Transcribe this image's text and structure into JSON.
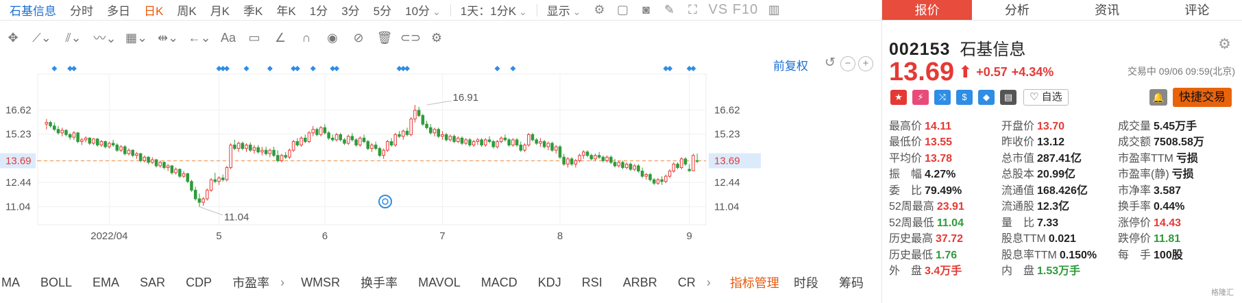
{
  "stock": {
    "code": "002153",
    "name": "石基信息"
  },
  "period_tabs": [
    "石基信息",
    "分时",
    "多日",
    "日K",
    "周K",
    "月K",
    "季K",
    "年K",
    "1分",
    "3分",
    "5分",
    "10分"
  ],
  "period_selected": "日K",
  "period_range": "1天：1分K",
  "display_label": "显示",
  "vs_label": "VS F10",
  "draw_tools": [
    "move-icon",
    "line-icon",
    "channel-icon",
    "wave-icon",
    "fib-icon",
    "range-icon",
    "arrow-icon",
    "text-icon",
    "comment-icon",
    "ruler-icon",
    "magnet-icon",
    "eye-icon",
    "lock-icon",
    "trash-icon",
    "link-icon",
    "settings-icon"
  ],
  "adjust_label": "前复权",
  "indicators": [
    "MA",
    "BOLL",
    "EMA",
    "SAR",
    "CDP",
    "市盈率",
    "WMSR",
    "换手率",
    "MAVOL",
    "MACD",
    "KDJ",
    "RSI",
    "ARBR",
    "CR"
  ],
  "indicator_manage": "指标管理",
  "right_links": [
    "时段",
    "筹码"
  ],
  "colors": {
    "up": "#e53935",
    "down": "#2e9b3a",
    "accent": "#e8590c",
    "link": "#1a6fd1"
  },
  "chart_data": {
    "type": "candlestick",
    "y_ticks": [
      16.62,
      15.23,
      13.69,
      12.44,
      11.04
    ],
    "y_range": [
      10.0,
      17.9
    ],
    "x_labels": [
      "2022/04",
      "5",
      "6",
      "7",
      "8",
      "9"
    ],
    "x_label_index": [
      16,
      44,
      71,
      101,
      131,
      164
    ],
    "current_price": 13.69,
    "annotations": [
      {
        "label": "16.91",
        "index": 97,
        "value": 16.91
      },
      {
        "label": "11.04",
        "index": 39,
        "value": 11.04
      }
    ],
    "event_marker_index": [
      2,
      6,
      7,
      44,
      45,
      46,
      51,
      57,
      63,
      64,
      68,
      73,
      74,
      90,
      91,
      92,
      115,
      119,
      158,
      159,
      164,
      165
    ],
    "ohlc": [
      [
        15.8,
        16.1,
        15.5,
        15.9
      ],
      [
        15.9,
        16.0,
        15.6,
        15.7
      ],
      [
        15.7,
        15.9,
        15.4,
        15.5
      ],
      [
        15.5,
        15.7,
        15.2,
        15.3
      ],
      [
        15.3,
        15.6,
        15.1,
        15.45
      ],
      [
        15.45,
        15.5,
        15.1,
        15.2
      ],
      [
        15.2,
        15.3,
        14.9,
        15.05
      ],
      [
        15.05,
        15.4,
        14.9,
        15.3
      ],
      [
        15.3,
        15.35,
        14.7,
        14.8
      ],
      [
        14.8,
        15.0,
        14.6,
        14.9
      ],
      [
        14.9,
        15.1,
        14.75,
        15.0
      ],
      [
        15.0,
        15.05,
        14.6,
        14.7
      ],
      [
        14.7,
        15.0,
        14.6,
        14.95
      ],
      [
        14.95,
        15.0,
        14.5,
        14.6
      ],
      [
        14.6,
        14.9,
        14.5,
        14.8
      ],
      [
        14.8,
        14.85,
        14.4,
        14.5
      ],
      [
        14.5,
        14.8,
        14.4,
        14.7
      ],
      [
        14.7,
        14.9,
        14.5,
        14.6
      ],
      [
        14.6,
        14.7,
        14.2,
        14.3
      ],
      [
        14.3,
        14.6,
        14.2,
        14.5
      ],
      [
        14.5,
        14.6,
        14.0,
        14.1
      ],
      [
        14.1,
        14.4,
        14.0,
        14.3
      ],
      [
        14.3,
        14.35,
        13.9,
        14.0
      ],
      [
        14.0,
        14.2,
        13.8,
        14.1
      ],
      [
        14.1,
        14.15,
        13.6,
        13.7
      ],
      [
        13.7,
        14.0,
        13.6,
        13.9
      ],
      [
        13.9,
        13.95,
        13.5,
        13.6
      ],
      [
        13.6,
        13.9,
        13.5,
        13.75
      ],
      [
        13.75,
        13.8,
        13.3,
        13.4
      ],
      [
        13.4,
        13.7,
        13.3,
        13.6
      ],
      [
        13.6,
        13.65,
        13.2,
        13.3
      ],
      [
        13.3,
        13.5,
        13.1,
        13.4
      ],
      [
        13.4,
        13.45,
        12.9,
        13.0
      ],
      [
        13.0,
        13.3,
        12.9,
        13.2
      ],
      [
        13.2,
        13.25,
        12.7,
        12.8
      ],
      [
        12.8,
        13.1,
        12.7,
        12.95
      ],
      [
        12.95,
        13.0,
        12.4,
        12.5
      ],
      [
        12.5,
        12.6,
        11.9,
        12.0
      ],
      [
        12.0,
        12.2,
        11.4,
        11.5
      ],
      [
        11.5,
        11.8,
        11.04,
        11.3
      ],
      [
        11.3,
        11.6,
        11.1,
        11.5
      ],
      [
        11.5,
        12.1,
        11.4,
        12.0
      ],
      [
        12.0,
        12.7,
        11.9,
        12.6
      ],
      [
        12.6,
        13.0,
        12.4,
        12.5
      ],
      [
        12.5,
        12.8,
        12.3,
        12.7
      ],
      [
        12.7,
        12.9,
        12.5,
        12.6
      ],
      [
        12.6,
        13.4,
        12.5,
        13.3
      ],
      [
        13.3,
        14.7,
        13.2,
        14.6
      ],
      [
        14.6,
        14.9,
        14.3,
        14.4
      ],
      [
        14.4,
        14.8,
        14.2,
        14.7
      ],
      [
        14.7,
        14.8,
        14.3,
        14.4
      ],
      [
        14.4,
        14.7,
        14.2,
        14.6
      ],
      [
        14.6,
        14.75,
        14.2,
        14.3
      ],
      [
        14.3,
        14.6,
        14.1,
        14.45
      ],
      [
        14.45,
        14.6,
        14.1,
        14.2
      ],
      [
        14.2,
        14.5,
        14.0,
        14.3
      ],
      [
        14.3,
        14.5,
        14.0,
        14.1
      ],
      [
        14.1,
        14.4,
        13.9,
        14.3
      ],
      [
        14.3,
        14.5,
        13.9,
        14.0
      ],
      [
        14.0,
        14.3,
        13.6,
        13.7
      ],
      [
        13.7,
        14.1,
        13.6,
        14.0
      ],
      [
        14.0,
        14.2,
        13.8,
        13.9
      ],
      [
        13.9,
        14.4,
        13.8,
        14.3
      ],
      [
        14.3,
        14.9,
        14.2,
        14.8
      ],
      [
        14.8,
        15.0,
        14.5,
        14.6
      ],
      [
        14.6,
        15.1,
        14.5,
        15.0
      ],
      [
        15.0,
        15.2,
        14.7,
        14.8
      ],
      [
        14.8,
        15.4,
        14.7,
        15.3
      ],
      [
        15.3,
        15.7,
        15.1,
        15.5
      ],
      [
        15.5,
        15.6,
        15.1,
        15.2
      ],
      [
        15.2,
        15.7,
        15.1,
        15.6
      ],
      [
        15.6,
        15.8,
        15.2,
        15.3
      ],
      [
        15.3,
        15.4,
        14.9,
        15.0
      ],
      [
        15.0,
        15.2,
        14.8,
        14.9
      ],
      [
        14.9,
        15.3,
        14.8,
        15.2
      ],
      [
        15.2,
        15.3,
        14.8,
        14.9
      ],
      [
        14.9,
        15.0,
        14.6,
        14.7
      ],
      [
        14.7,
        15.2,
        14.6,
        15.1
      ],
      [
        15.1,
        15.3,
        14.8,
        14.9
      ],
      [
        14.9,
        15.0,
        14.5,
        14.6
      ],
      [
        14.6,
        15.1,
        14.5,
        15.0
      ],
      [
        15.0,
        15.2,
        14.7,
        14.8
      ],
      [
        14.8,
        14.9,
        14.3,
        14.4
      ],
      [
        14.4,
        14.7,
        14.2,
        14.6
      ],
      [
        14.6,
        14.8,
        14.3,
        14.4
      ],
      [
        14.4,
        14.5,
        13.9,
        14.0
      ],
      [
        14.0,
        14.4,
        13.8,
        14.3
      ],
      [
        14.3,
        14.9,
        14.2,
        14.8
      ],
      [
        14.8,
        15.0,
        14.5,
        14.6
      ],
      [
        14.6,
        15.3,
        14.5,
        15.2
      ],
      [
        15.2,
        15.4,
        15.0,
        15.1
      ],
      [
        15.1,
        15.5,
        14.9,
        15.4
      ],
      [
        15.4,
        15.6,
        15.1,
        15.2
      ],
      [
        15.2,
        16.2,
        15.1,
        16.1
      ],
      [
        16.1,
        16.91,
        15.9,
        16.6
      ],
      [
        16.6,
        16.8,
        16.2,
        16.3
      ],
      [
        16.3,
        16.4,
        15.7,
        15.8
      ],
      [
        15.8,
        16.0,
        15.5,
        15.6
      ],
      [
        15.6,
        15.8,
        15.2,
        15.3
      ],
      [
        15.3,
        15.6,
        15.1,
        15.5
      ],
      [
        15.5,
        15.6,
        15.0,
        15.1
      ],
      [
        15.1,
        15.4,
        14.9,
        15.2
      ],
      [
        15.2,
        15.3,
        14.8,
        14.9
      ],
      [
        14.9,
        15.2,
        14.8,
        15.1
      ],
      [
        15.1,
        15.2,
        14.7,
        14.8
      ],
      [
        14.8,
        15.1,
        14.7,
        15.0
      ],
      [
        15.0,
        15.1,
        14.6,
        14.7
      ],
      [
        14.7,
        15.0,
        14.6,
        14.9
      ],
      [
        14.9,
        15.0,
        14.5,
        14.6
      ],
      [
        14.6,
        14.9,
        14.5,
        14.8
      ],
      [
        14.8,
        15.0,
        14.6,
        14.9
      ],
      [
        14.9,
        15.0,
        14.5,
        14.6
      ],
      [
        14.6,
        15.0,
        14.5,
        14.9
      ],
      [
        14.9,
        15.1,
        14.7,
        14.8
      ],
      [
        14.8,
        14.9,
        14.4,
        14.5
      ],
      [
        14.5,
        14.9,
        14.4,
        14.8
      ],
      [
        14.8,
        15.1,
        14.7,
        15.0
      ],
      [
        15.0,
        15.2,
        14.8,
        14.9
      ],
      [
        14.9,
        15.0,
        14.5,
        14.6
      ],
      [
        14.6,
        15.0,
        14.5,
        14.9
      ],
      [
        14.9,
        15.0,
        14.5,
        14.6
      ],
      [
        14.6,
        14.8,
        14.2,
        14.3
      ],
      [
        14.3,
        14.7,
        14.2,
        14.6
      ],
      [
        14.6,
        15.3,
        14.5,
        15.2
      ],
      [
        15.2,
        15.3,
        14.8,
        14.9
      ],
      [
        14.9,
        15.0,
        14.6,
        14.7
      ],
      [
        14.7,
        15.0,
        14.5,
        14.8
      ],
      [
        14.8,
        14.9,
        14.4,
        14.5
      ],
      [
        14.5,
        14.8,
        14.3,
        14.7
      ],
      [
        14.7,
        14.8,
        14.2,
        14.3
      ],
      [
        14.3,
        14.6,
        14.1,
        14.5
      ],
      [
        14.5,
        14.6,
        13.8,
        13.9
      ],
      [
        13.9,
        14.1,
        13.4,
        13.5
      ],
      [
        13.5,
        13.9,
        13.3,
        13.8
      ],
      [
        13.8,
        13.9,
        13.4,
        13.5
      ],
      [
        13.5,
        13.8,
        13.3,
        13.7
      ],
      [
        13.7,
        14.1,
        13.6,
        14.0
      ],
      [
        14.0,
        14.3,
        13.8,
        14.2
      ],
      [
        14.2,
        14.3,
        13.9,
        14.0
      ],
      [
        14.0,
        14.1,
        13.7,
        13.8
      ],
      [
        13.8,
        14.1,
        13.7,
        14.0
      ],
      [
        14.0,
        14.2,
        13.8,
        13.9
      ],
      [
        13.9,
        14.0,
        13.6,
        13.7
      ],
      [
        13.7,
        14.0,
        13.6,
        13.9
      ],
      [
        13.9,
        14.0,
        13.5,
        13.6
      ],
      [
        13.6,
        13.8,
        13.3,
        13.4
      ],
      [
        13.4,
        13.7,
        13.3,
        13.6
      ],
      [
        13.6,
        13.7,
        13.2,
        13.3
      ],
      [
        13.3,
        13.6,
        13.2,
        13.5
      ],
      [
        13.5,
        13.6,
        13.1,
        13.2
      ],
      [
        13.2,
        13.5,
        13.1,
        13.4
      ],
      [
        13.4,
        13.5,
        13.0,
        13.1
      ],
      [
        13.1,
        13.3,
        12.7,
        12.8
      ],
      [
        12.8,
        13.0,
        12.6,
        12.9
      ],
      [
        12.9,
        13.0,
        12.5,
        12.6
      ],
      [
        12.6,
        12.7,
        12.3,
        12.4
      ],
      [
        12.4,
        12.7,
        12.3,
        12.6
      ],
      [
        12.6,
        12.8,
        12.3,
        12.5
      ],
      [
        12.5,
        12.9,
        12.4,
        12.8
      ],
      [
        12.8,
        13.2,
        12.7,
        13.1
      ],
      [
        13.1,
        13.6,
        13.0,
        13.5
      ],
      [
        13.5,
        13.6,
        13.2,
        13.3
      ],
      [
        13.3,
        13.9,
        13.2,
        13.8
      ],
      [
        13.8,
        13.9,
        13.4,
        13.5
      ],
      [
        13.2,
        13.5,
        13.05,
        13.12
      ],
      [
        13.12,
        14.1,
        13.1,
        14.0
      ],
      [
        13.7,
        14.11,
        13.55,
        13.69
      ]
    ]
  },
  "quote": {
    "tabs": [
      "报价",
      "分析",
      "资讯",
      "评论"
    ],
    "selected_tab": "报价",
    "price": "13.69",
    "change": "+0.57",
    "change_pct": "+4.34%",
    "status": "交易中 09/06 09:59(北京)",
    "badges": [
      {
        "icon": "china-flag-icon",
        "glyph": "★",
        "color": "#e53935"
      },
      {
        "icon": "margin-icon",
        "glyph": "⚡",
        "color": "#e84b7a"
      },
      {
        "icon": "shuffle-icon",
        "glyph": "⤨",
        "color": "#2f8de4"
      },
      {
        "icon": "dollar-icon",
        "glyph": "$",
        "color": "#2f8de4"
      },
      {
        "icon": "tag-icon",
        "glyph": "◆",
        "color": "#2f8de4"
      },
      {
        "icon": "book-icon",
        "glyph": "▤",
        "color": "#555"
      }
    ],
    "watch_label": "自选",
    "fast_trade_label": "快捷交易",
    "stats": [
      [
        [
          "最高价",
          "14.11",
          "red"
        ],
        [
          "开盘价",
          "13.70",
          "red"
        ],
        [
          "成交量",
          "5.45万手",
          "dark"
        ]
      ],
      [
        [
          "最低价",
          "13.55",
          "red"
        ],
        [
          "昨收价",
          "13.12",
          "dark"
        ],
        [
          "成交额",
          "7508.58万",
          "dark"
        ]
      ],
      [
        [
          "平均价",
          "13.78",
          "red"
        ],
        [
          "总市值",
          "287.41亿",
          "dark"
        ],
        [
          "市盈率TTM",
          "亏损",
          "dark"
        ]
      ],
      [
        [
          "振　幅",
          "4.27%",
          "dark"
        ],
        [
          "总股本",
          "20.99亿",
          "dark"
        ],
        [
          "市盈率(静)",
          "亏损",
          "dark"
        ]
      ],
      [
        [
          "委　比",
          "79.49%",
          "dark"
        ],
        [
          "流通值",
          "168.426亿",
          "dark"
        ],
        [
          "市净率",
          "3.587",
          "dark"
        ]
      ],
      [
        [
          "52周最高",
          "23.91",
          "red"
        ],
        [
          "流通股",
          "12.3亿",
          "dark"
        ],
        [
          "换手率",
          "0.44%",
          "dark"
        ]
      ],
      [
        [
          "52周最低",
          "11.04",
          "green"
        ],
        [
          "量　比",
          "7.33",
          "dark"
        ],
        [
          "涨停价",
          "14.43",
          "red"
        ]
      ],
      [
        [
          "历史最高",
          "37.72",
          "red"
        ],
        [
          "股息TTM",
          "0.021",
          "dark"
        ],
        [
          "跌停价",
          "11.81",
          "green"
        ]
      ],
      [
        [
          "历史最低",
          "1.76",
          "green"
        ],
        [
          "股息率TTM",
          "0.150%",
          "dark"
        ],
        [
          "每　手",
          "100股",
          "dark"
        ]
      ],
      [
        [
          "外　盘",
          "3.4万手",
          "red"
        ],
        [
          "内　盘",
          "1.53万手",
          "green"
        ],
        [
          "",
          "",
          " "
        ]
      ]
    ]
  },
  "watermark": "格隆汇"
}
